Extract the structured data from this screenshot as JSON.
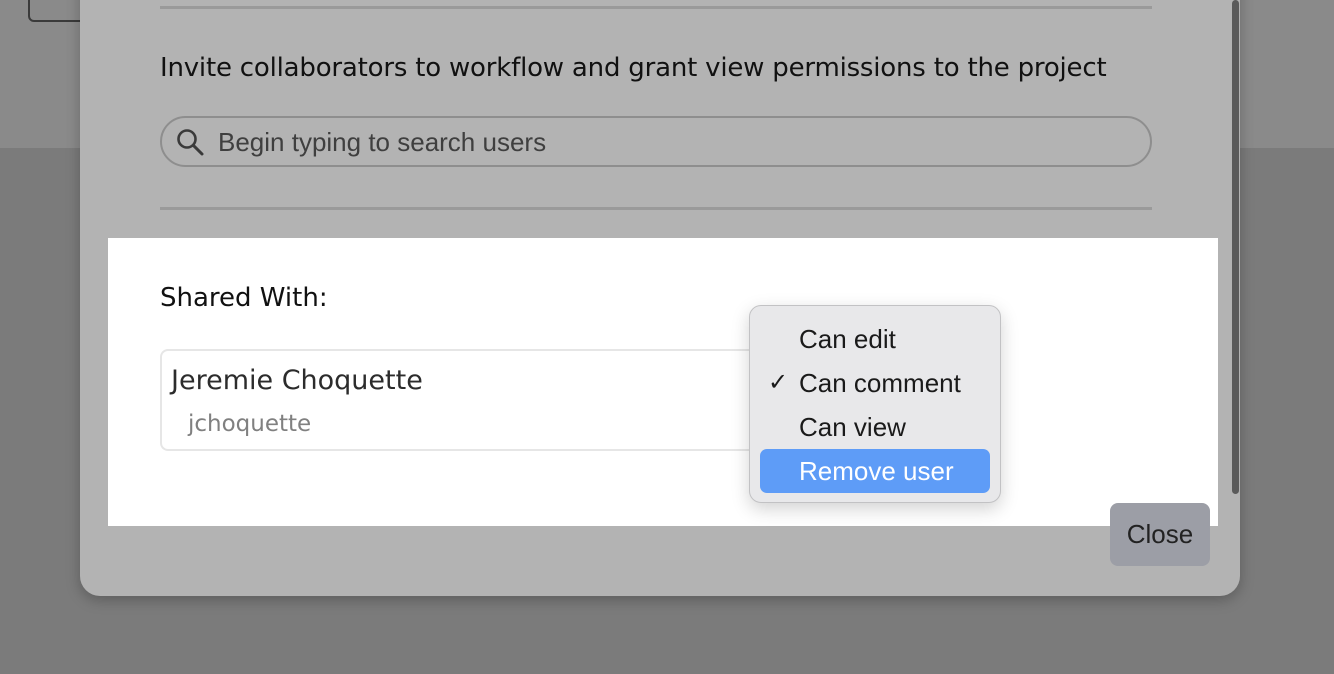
{
  "invite": {
    "label": "Invite collaborators to workflow and grant view permissions to the project",
    "search_placeholder": "Begin typing to search users"
  },
  "shared": {
    "title": "Shared With:",
    "users": [
      {
        "name": "Jeremie Choquette",
        "username": "jchoquette"
      }
    ]
  },
  "permission_menu": {
    "items": [
      {
        "label": "Can edit",
        "checked": false
      },
      {
        "label": "Can comment",
        "checked": true
      },
      {
        "label": "Can view",
        "checked": false
      },
      {
        "label": "Remove user",
        "checked": false,
        "highlighted": true
      }
    ],
    "check_glyph": "✓"
  },
  "footer": {
    "close_label": "Close"
  },
  "colors": {
    "menu_highlight": "#5e9cf7",
    "overlay": "#7b7b7b",
    "modal": "#b3b3b3",
    "panel": "#ffffff"
  }
}
